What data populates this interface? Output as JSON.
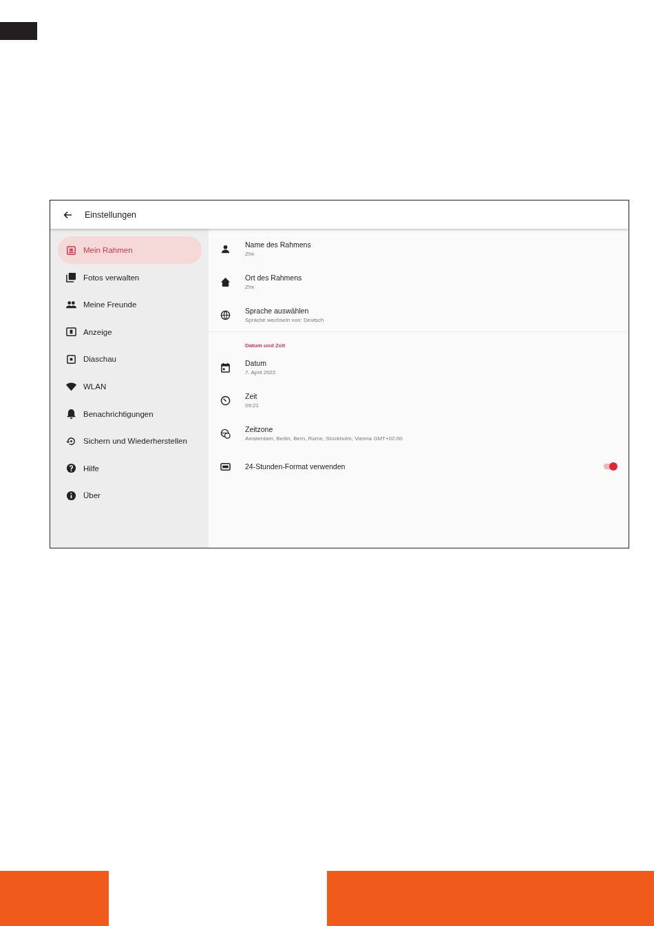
{
  "window": {
    "title": "Einstellungen"
  },
  "sidebar": {
    "items": [
      {
        "label": "Mein Rahmen",
        "selected": true
      },
      {
        "label": "Fotos verwalten",
        "selected": false
      },
      {
        "label": "Meine Freunde",
        "selected": false
      },
      {
        "label": "Anzeige",
        "selected": false
      },
      {
        "label": "Diaschau",
        "selected": false
      },
      {
        "label": "WLAN",
        "selected": false
      },
      {
        "label": "Benachrichtigungen",
        "selected": false
      },
      {
        "label": "Sichern und Wiederherstellen",
        "selected": false
      },
      {
        "label": "Hilfe",
        "selected": false
      },
      {
        "label": "Über",
        "selected": false
      }
    ]
  },
  "settings": {
    "sections": [
      {
        "items": [
          {
            "kind": "text",
            "title": "Name des Rahmens",
            "subtitle": "Zhx"
          },
          {
            "kind": "text",
            "title": "Ort des Rahmens",
            "subtitle": "Zhx"
          },
          {
            "kind": "text",
            "title": "Sprache auswählen",
            "subtitle": "Sprache wechseln von: Deutsch"
          }
        ]
      },
      {
        "header": "Datum und Zeit",
        "items": [
          {
            "kind": "text",
            "title": "Datum",
            "subtitle": "7. April 2022"
          },
          {
            "kind": "text",
            "title": "Zeit",
            "subtitle": "09:21"
          },
          {
            "kind": "text",
            "title": "Zeitzone",
            "subtitle": "Amsterdam, Berlin, Bern, Rome, Stockholm, Vienna GMT+02:00"
          },
          {
            "kind": "switch",
            "title": "24-Stunden-Format verwenden",
            "on": true
          }
        ]
      }
    ]
  }
}
